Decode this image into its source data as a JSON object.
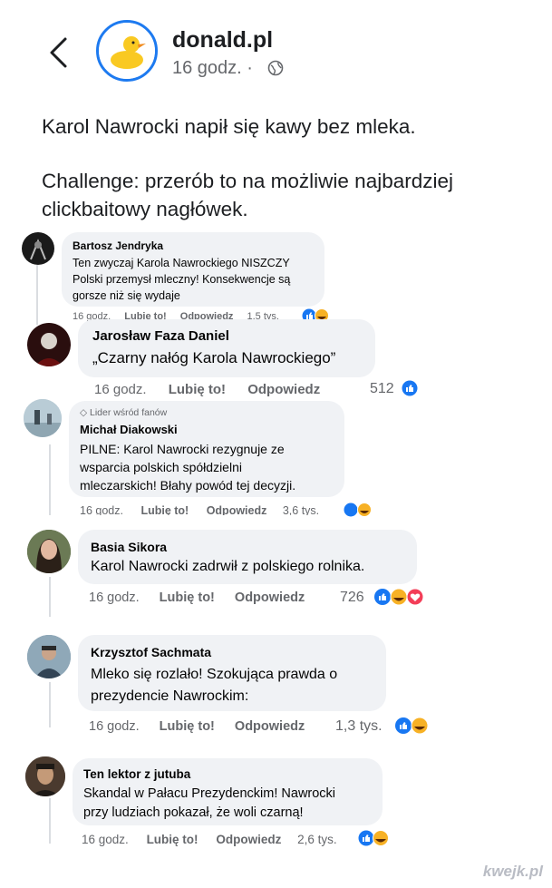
{
  "header": {
    "page_name": "donald.pl",
    "time": "16 godz. ·"
  },
  "post": {
    "line1": "Karol Nawrocki napił się kawy bez mleka.",
    "line2": "Challenge: przerób to na możliwie najbardziej",
    "line3": "clickbaitowy nagłówek."
  },
  "comments": [
    {
      "name": "Bartosz Jendryka",
      "lines": [
        "Ten zwyczaj Karola Nawrockiego NISZCZY",
        "Polski przemysł mleczny! Konsekwencje są",
        "gorsze niż się wydaje"
      ],
      "time": "16 godz.",
      "like": "Lubię to!",
      "reply": "Odpowiedz",
      "count": "1,5 tys."
    },
    {
      "name": "Jarosław Faza Daniel",
      "lines": [
        "„Czarny nałóg Karola Nawrockiego”"
      ],
      "time": "16 godz.",
      "like": "Lubię to!",
      "reply": "Odpowiedz",
      "count": "512"
    },
    {
      "badge": "Lider wśród fanów",
      "name": "Michał Diakowski",
      "lines": [
        "PILNE: Karol Nawrocki rezygnuje ze",
        "wsparcia polskich spółdzielni",
        "mleczarskich!  Błahy powód tej decyzji."
      ],
      "time": "16 godz.",
      "like": "Lubię to!",
      "reply": "Odpowiedz",
      "count": "3,6 tys."
    },
    {
      "name": "Basia Sikora",
      "lines": [
        "Karol Nawrocki zadrwił z polskiego rolnika."
      ],
      "time": "16 godz.",
      "like": "Lubię to!",
      "reply": "Odpowiedz",
      "count": "726"
    },
    {
      "name": "Krzysztof Sachmata",
      "lines": [
        "Mleko się rozlało! Szokująca prawda o",
        "prezydencie Nawrockim:"
      ],
      "time": "16 godz.",
      "like": "Lubię to!",
      "reply": "Odpowiedz",
      "count": "1,3 tys."
    },
    {
      "name": "Ten lektor z jutuba",
      "lines": [
        "Skandal w Pałacu Prezydenckim! Nawrocki",
        "przy ludziach pokazał, że woli czarną!"
      ],
      "time": "16 godz.",
      "like": "Lubię to!",
      "reply": "Odpowiedz",
      "count": "2,6 tys."
    }
  ],
  "watermark": "kwejk.pl",
  "colors": {
    "like_blue": "#1877f2",
    "haha_yellow": "#f7b125",
    "love_red": "#f33e58",
    "bubble": "#f0f2f5"
  }
}
